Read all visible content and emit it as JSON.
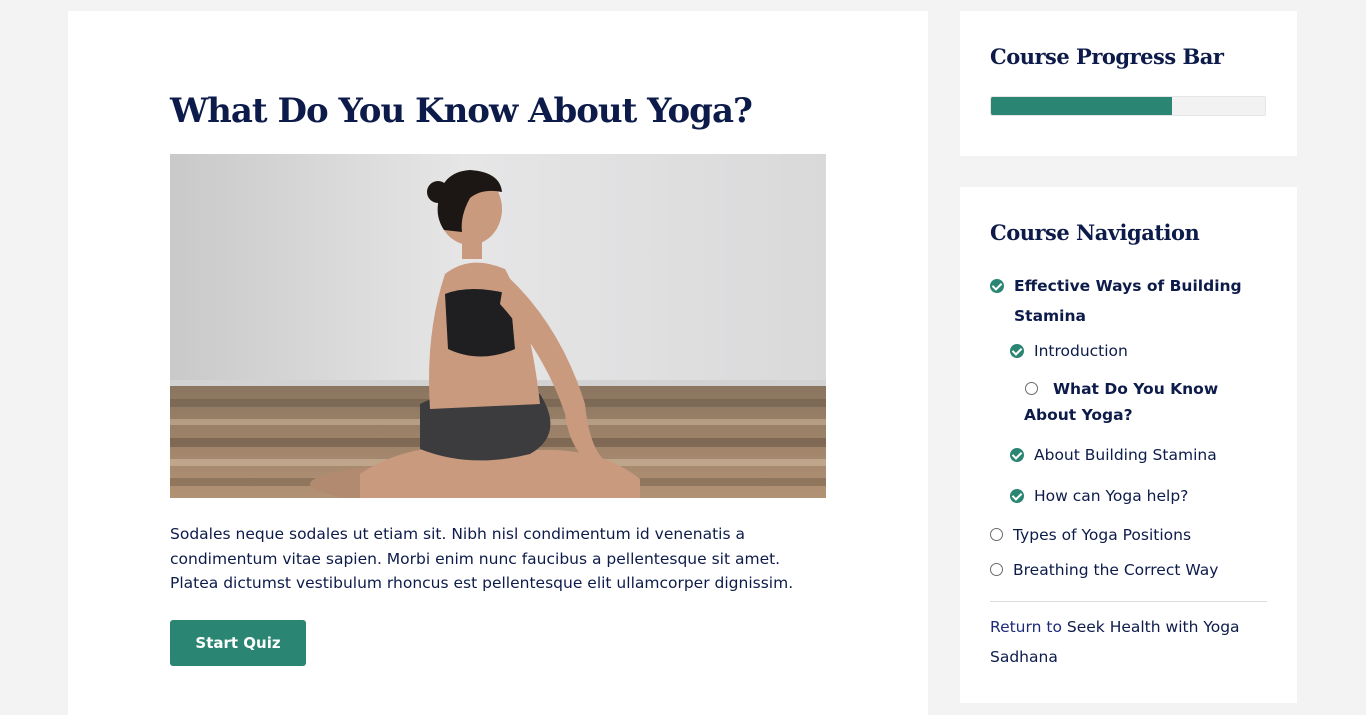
{
  "lesson": {
    "title": "What Do You Know About Yoga?",
    "image_alt": "Woman seated cross-legged doing a yoga twist on a wooden floor",
    "body": "Sodales neque sodales ut etiam sit. Nibh nisl condimentum id venenatis a condimentum vitae sapien. Morbi enim nunc faucibus a pellentesque sit amet. Platea dictumst vestibulum rhoncus est pellentesque elit ullamcorper dignissim.",
    "start_button": "Start Quiz"
  },
  "progress": {
    "title": "Course Progress Bar",
    "percent": 66
  },
  "navigation": {
    "title": "Course Navigation",
    "items": [
      {
        "label": "Effective Ways of Building Stamina",
        "status": "complete",
        "level": 0,
        "current": true
      },
      {
        "label": "Introduction",
        "status": "complete",
        "level": 1
      },
      {
        "label": "What Do You Know About Yoga?",
        "status": "incomplete",
        "level": 2,
        "current": true
      },
      {
        "label": "About Building Stamina",
        "status": "complete",
        "level": 1
      },
      {
        "label": "How can Yoga help?",
        "status": "complete",
        "level": 1
      },
      {
        "label": "Types of Yoga Positions",
        "status": "incomplete",
        "level": 0
      },
      {
        "label": "Breathing the Correct Way",
        "status": "incomplete",
        "level": 0
      }
    ],
    "return_prefix": "Return to",
    "return_course": "Seek Health with Yoga Sadhana"
  },
  "colors": {
    "accent": "#2a8572",
    "text": "#0d1b4a",
    "background": "#f3f3f3"
  },
  "icons": {
    "complete": "check-circle-icon",
    "incomplete": "empty-circle-icon"
  }
}
